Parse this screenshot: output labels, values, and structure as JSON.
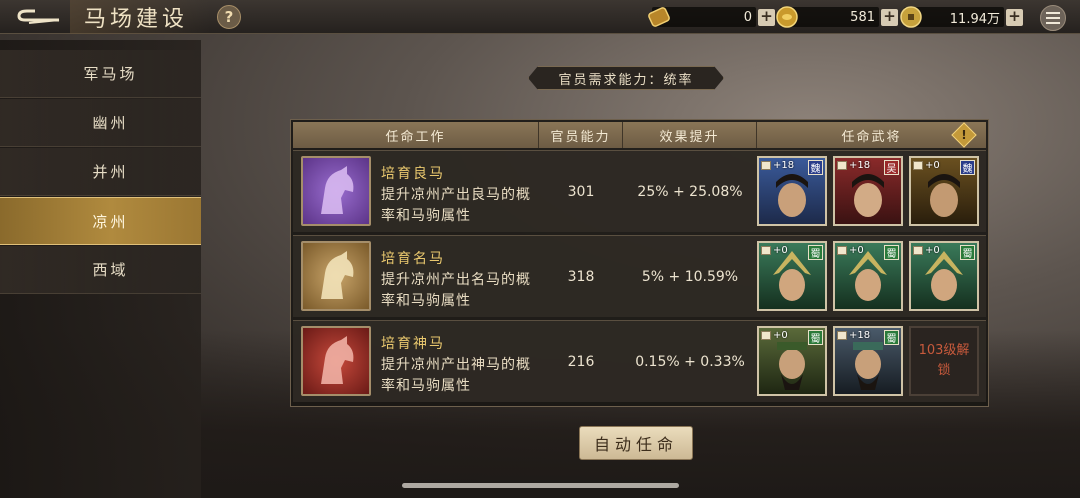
{
  "header": {
    "title": "马场建设",
    "help_label": "?",
    "resources": [
      {
        "name": "scroll",
        "value": "0"
      },
      {
        "name": "gold",
        "value": "581"
      },
      {
        "name": "copper",
        "value": "11.94万"
      }
    ]
  },
  "sidebar": {
    "items": [
      {
        "label": "军马场"
      },
      {
        "label": "幽州"
      },
      {
        "label": "并州"
      },
      {
        "label": "凉州",
        "active": true
      },
      {
        "label": "西域"
      }
    ]
  },
  "requirement": "官员需求能力：统率",
  "table": {
    "headers": [
      "任命工作",
      "官员能力",
      "效果提升",
      "任命武将"
    ],
    "info_label": "!",
    "rows": [
      {
        "title": "培育良马",
        "desc": "提升凉州产出良马的概率和马驹属性",
        "ability": "301",
        "effect": "25% + 25.08%",
        "horse_color": "#7a4fb0",
        "generals": [
          {
            "bonus": "+18",
            "kingdom": "魏"
          },
          {
            "bonus": "+18",
            "kingdom": "吴"
          },
          {
            "bonus": "+0",
            "kingdom": "魏"
          }
        ]
      },
      {
        "title": "培育名马",
        "desc": "提升凉州产出名马的概率和马驹属性",
        "ability": "318",
        "effect": "5% + 10.59%",
        "horse_color": "#b08a4a",
        "generals": [
          {
            "bonus": "+0",
            "kingdom": "蜀"
          },
          {
            "bonus": "+0",
            "kingdom": "蜀"
          },
          {
            "bonus": "+0",
            "kingdom": "蜀"
          }
        ]
      },
      {
        "title": "培育神马",
        "desc": "提升凉州产出神马的概率和马驹属性",
        "ability": "216",
        "effect": "0.15% + 0.33%",
        "horse_color": "#a8302c",
        "generals": [
          {
            "bonus": "+0",
            "kingdom": "蜀"
          },
          {
            "bonus": "+18",
            "kingdom": "蜀"
          }
        ],
        "locked_label": "103级解锁"
      }
    ]
  },
  "auto_button": "自动任命"
}
